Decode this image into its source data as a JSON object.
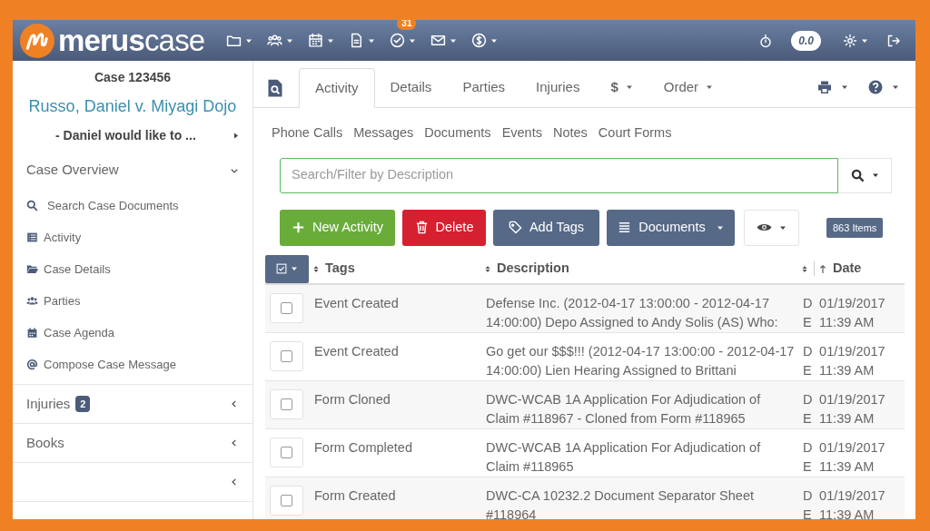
{
  "header": {
    "logo": {
      "bold": "merus",
      "light": "case"
    },
    "tasks_badge": "31",
    "timer": "0.0"
  },
  "sidebar": {
    "case_number": "Case 123456",
    "case_name": "Russo, Daniel v. Miyagi Dojo",
    "case_note": "- Daniel would like to ...",
    "sections": [
      {
        "label": "Case Overview",
        "expanded": true,
        "items": [
          "Search Case Documents",
          "Activity",
          "Case Details",
          "Parties",
          "Case Agenda",
          "Compose Case Message"
        ]
      },
      {
        "label": "Injuries",
        "badge": "2",
        "expanded": false
      },
      {
        "label": "Books",
        "expanded": false
      },
      {
        "expanded": false
      }
    ]
  },
  "tabs": [
    {
      "label": "Activity",
      "selected": true,
      "caret": false
    },
    {
      "label": "Details",
      "selected": false,
      "caret": false
    },
    {
      "label": "Parties",
      "selected": false,
      "caret": false
    },
    {
      "label": "Injuries",
      "selected": false,
      "caret": false
    },
    {
      "label": "$",
      "selected": false,
      "caret": true
    },
    {
      "label": "Order",
      "selected": false,
      "caret": true
    }
  ],
  "subtabs": [
    "Phone Calls",
    "Messages",
    "Documents",
    "Events",
    "Notes",
    "Court Forms"
  ],
  "search": {
    "placeholder": "Search/Filter by Description"
  },
  "toolbar": [
    {
      "kind": "success",
      "label": "New Activity"
    },
    {
      "kind": "danger",
      "label": "Delete"
    },
    {
      "kind": "tags",
      "label": "Add Tags"
    },
    {
      "kind": "documents",
      "label": "Documents"
    }
  ],
  "item_count": "863 Items",
  "table": {
    "columns": [
      "Tags",
      "Description",
      "Date"
    ],
    "rows": [
      {
        "checked": false,
        "tags": "Event Created",
        "description": "Defense Inc. (2012-04-17 13:00:00 - 2012-04-17 14:00:00) Depo Assigned to Andy Solis (AS) Who:",
        "column_3": "DE",
        "date": "01/19/2017 11:39 AM"
      },
      {
        "checked": false,
        "tags": "Event Created",
        "description": "Go get our $$$!!! (2012-04-17 13:00:00 - 2012-04-17 14:00:00) Lien Hearing Assigned to Brittani",
        "column_3": "DE",
        "date": "01/19/2017 11:39 AM"
      },
      {
        "checked": false,
        "tags": "Form Cloned",
        "description": "DWC-WCAB 1A Application For Adjudication of Claim #118967 - Cloned from Form #118965",
        "column_3": "DE",
        "date": "01/19/2017 11:39 AM"
      },
      {
        "checked": false,
        "tags": "Form Completed",
        "description": "DWC-WCAB 1A Application For Adjudication of Claim #118965",
        "column_3": "DE",
        "date": "01/19/2017 11:39 AM"
      },
      {
        "checked": false,
        "tags": "Form Created",
        "description": "DWC-CA 10232.2 Document Separator Sheet #118964",
        "column_3": "DE",
        "date": "01/19/2017 11:39 AM"
      }
    ]
  }
}
